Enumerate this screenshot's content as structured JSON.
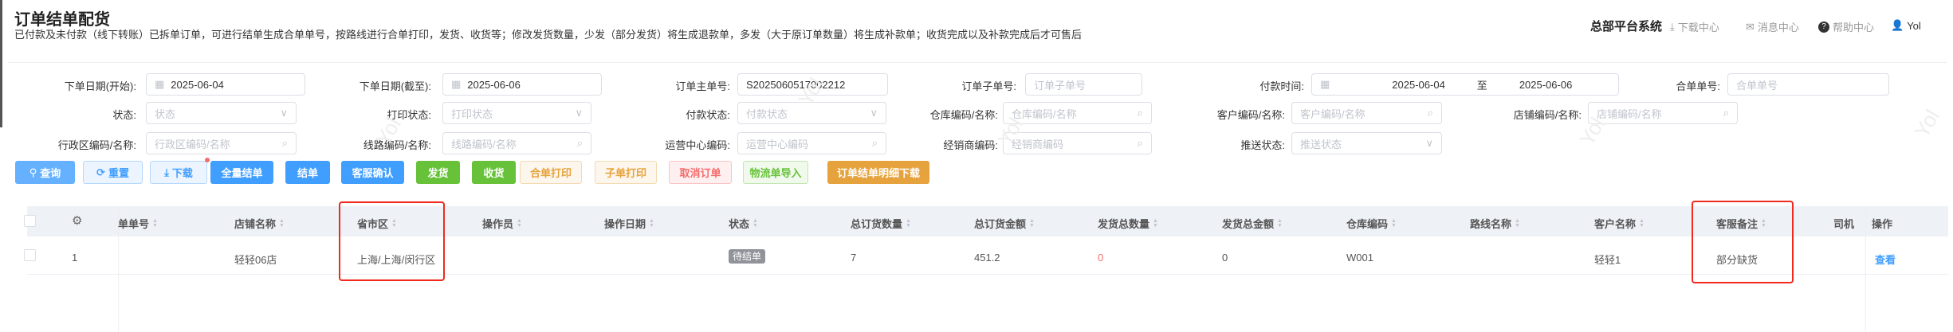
{
  "page": {
    "title": "订单结单配货",
    "subtitle": "已付款及未付款（线下转账）已拆单订单，可进行结单生成合单单号，按路线进行合单打印，发货、收货等；修改发货数量，少发（部分发货）将生成退款单，多发（大于原订单数量）将生成补款单；收货完成以及补款完成后才可售后"
  },
  "header": {
    "system_name": "总部平台系统",
    "download_center": "下载中心",
    "message_center": "消息中心",
    "help_center": "帮助中心",
    "user": "Yol"
  },
  "filters": [
    {
      "label": "下单日期(开始):",
      "value": "2025-06-04",
      "placeholder": "",
      "icon": "calendar-icon"
    },
    {
      "label": "下单日期(截至):",
      "value": "2025-06-06",
      "placeholder": "",
      "icon": "calendar-icon"
    },
    {
      "label": "订单主单号:",
      "value": "S2025060517002212",
      "placeholder": "",
      "icon": ""
    },
    {
      "label": "订单子单号:",
      "value": "",
      "placeholder": "订单子单号",
      "icon": ""
    },
    {
      "label": "付款时间:",
      "value": "2025-06-04",
      "value_end": "2025-06-06",
      "separator": "至",
      "icon": "calendar-icon"
    },
    {
      "label": "合单单号:",
      "value": "",
      "placeholder": "合单单号",
      "icon": ""
    },
    {
      "label": "状态:",
      "value": "",
      "placeholder": "状态",
      "icon": "chevron-down-icon"
    },
    {
      "label": "打印状态:",
      "value": "",
      "placeholder": "打印状态",
      "icon": "chevron-down-icon"
    },
    {
      "label": "付款状态:",
      "value": "",
      "placeholder": "付款状态",
      "icon": "chevron-down-icon"
    },
    {
      "label": "仓库编码/名称:",
      "value": "",
      "placeholder": "仓库编码/名称",
      "icon": "search-icon"
    },
    {
      "label": "客户编码/名称:",
      "value": "",
      "placeholder": "客户编码/名称",
      "icon": "search-icon"
    },
    {
      "label": "店铺编码/名称:",
      "value": "",
      "placeholder": "店铺编码/名称",
      "icon": "search-icon"
    },
    {
      "label": "行政区编码/名称:",
      "value": "",
      "placeholder": "行政区编码/名称",
      "icon": "search-icon"
    },
    {
      "label": "线路编码/名称:",
      "value": "",
      "placeholder": "线路编码/名称",
      "icon": "search-icon"
    },
    {
      "label": "运营中心编码:",
      "value": "",
      "placeholder": "运营中心编码",
      "icon": "search-icon"
    },
    {
      "label": "经销商编码:",
      "value": "",
      "placeholder": "经销商编码",
      "icon": "search-icon"
    },
    {
      "label": "推送状态:",
      "value": "",
      "placeholder": "推送状态",
      "icon": "chevron-down-icon"
    }
  ],
  "buttons": [
    {
      "label": "查询",
      "icon": "search-icon",
      "style": "primary-light"
    },
    {
      "label": "重置",
      "icon": "refresh-icon",
      "style": "plain-blue"
    },
    {
      "label": "下载",
      "icon": "download-icon",
      "style": "plain-blue"
    },
    {
      "label": "全量结单",
      "style": "primary"
    },
    {
      "label": "结单",
      "style": "primary"
    },
    {
      "label": "客服确认",
      "style": "primary"
    },
    {
      "label": "发货",
      "style": "success"
    },
    {
      "label": "收货",
      "style": "success"
    },
    {
      "label": "合单打印",
      "style": "plain-warning"
    },
    {
      "label": "子单打印",
      "style": "plain-warning"
    },
    {
      "label": "取消订单",
      "style": "plain-danger"
    },
    {
      "label": "物流单导入",
      "style": "plain-success"
    },
    {
      "label": "订单结单明细下载",
      "style": "warning"
    }
  ],
  "table": {
    "columns": [
      "单单号",
      "店铺名称",
      "省市区",
      "操作员",
      "操作日期",
      "状态",
      "总订货数量",
      "总订货金额",
      "发货总数量",
      "发货总金额",
      "仓库编码",
      "路线名称",
      "客户名称",
      "客服备注",
      "司机",
      "操作"
    ],
    "rows": [
      {
        "index": "1",
        "store": "轻轻06店",
        "region": "上海/上海/闵行区",
        "operator": "",
        "op_date": "",
        "status": "待结单",
        "total_qty": "7",
        "total_amount": "451.2",
        "ship_qty": "0",
        "ship_amount": "0",
        "warehouse": "W001",
        "route": "",
        "customer": "轻轻1",
        "cs_note": "部分缺货",
        "action": "查看"
      }
    ]
  },
  "watermark": "Yol",
  "colors": {
    "primary": "#409eff",
    "success": "#67c23a",
    "warning": "#e6a23c",
    "danger": "#f56c6c",
    "highlight": "#f02a1f"
  }
}
